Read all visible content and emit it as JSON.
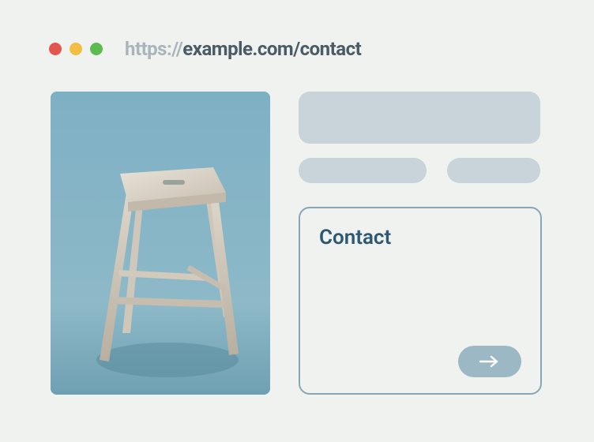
{
  "browser": {
    "url_protocol": "https://",
    "url_rest": "example.com/contact"
  },
  "contact": {
    "title": "Contact"
  }
}
